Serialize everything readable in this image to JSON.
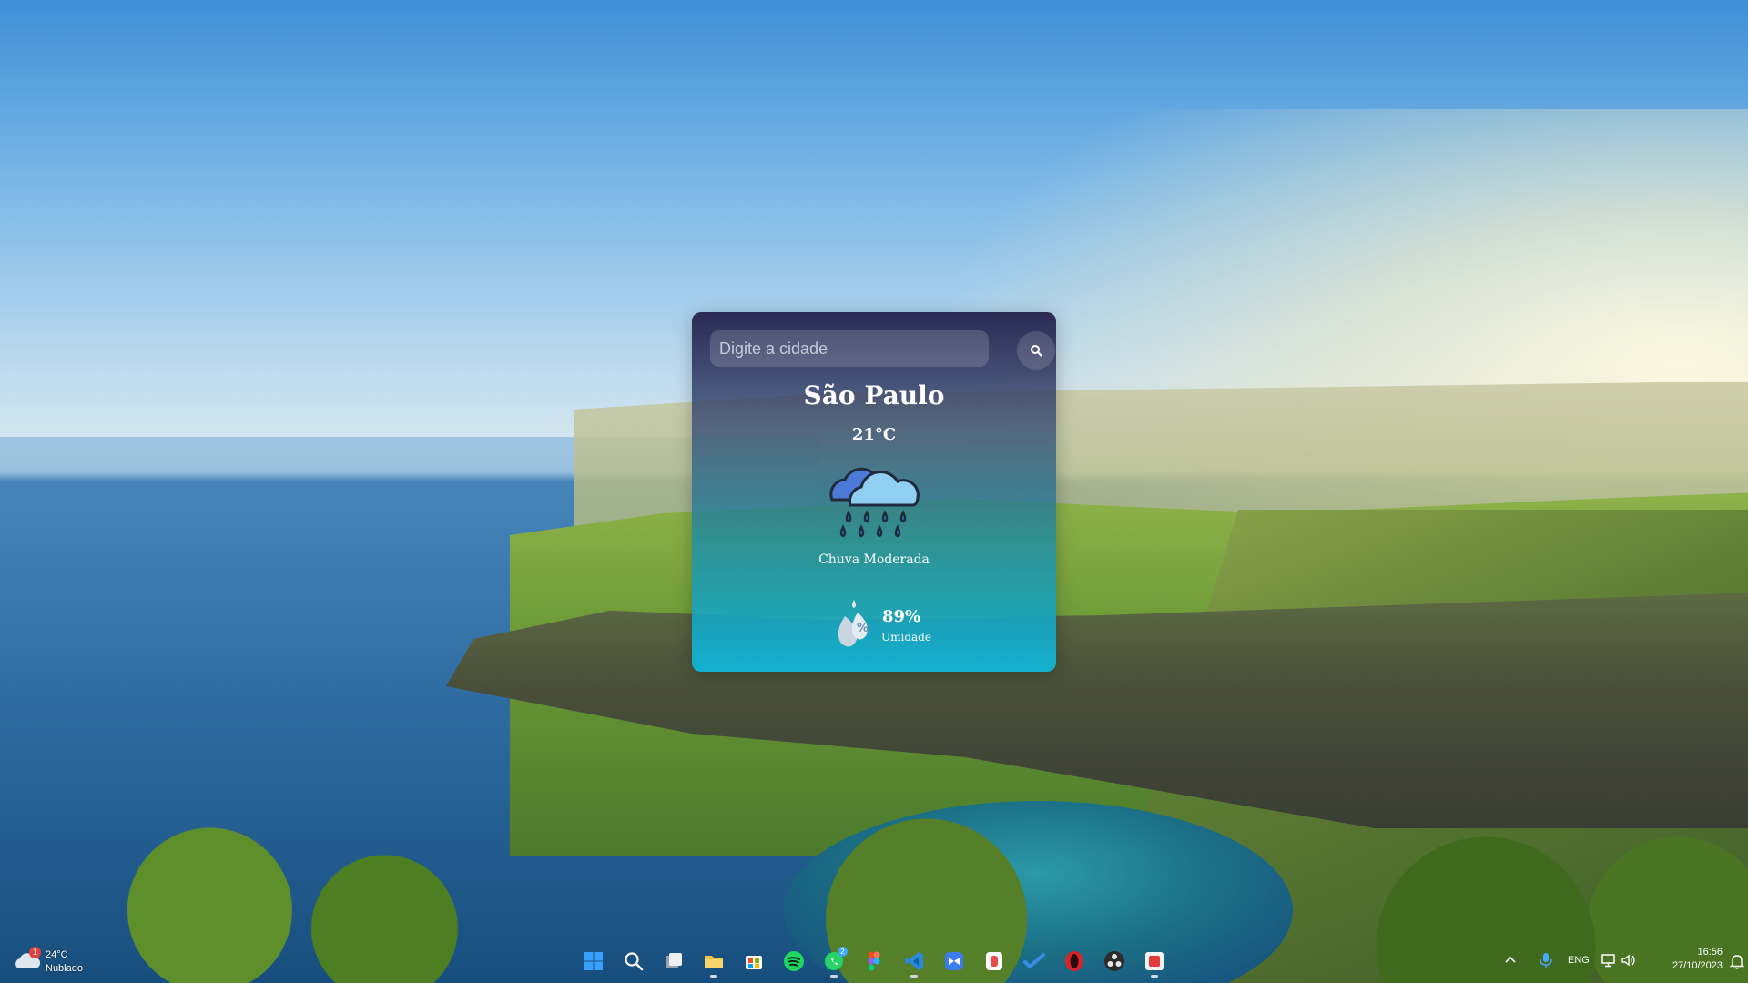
{
  "weather_app": {
    "search": {
      "placeholder": "Digite a cidade",
      "value": ""
    },
    "city": "São Paulo",
    "temperature": "21°C",
    "condition_icon": "cloud-rain-icon",
    "description": "Chuva Moderada",
    "humidity": {
      "value": "89%",
      "label": "Umidade",
      "icon": "humidity-drop-icon"
    }
  },
  "taskbar": {
    "widget": {
      "badge": "1",
      "temperature": "24°C",
      "condition": "Nublado",
      "icon": "cloudy-weather-icon"
    },
    "apps": [
      {
        "name": "start",
        "icon": "windows-start-icon",
        "color": "#3aa0ff"
      },
      {
        "name": "search",
        "icon": "search-icon",
        "color": "#ffffff"
      },
      {
        "name": "task-view",
        "icon": "task-view-icon",
        "color": "#e6e6e6"
      },
      {
        "name": "file-explorer",
        "icon": "folder-icon",
        "color": "#f6c343"
      },
      {
        "name": "microsoft-store",
        "icon": "store-icon",
        "color": "#2f8fe8"
      },
      {
        "name": "spotify",
        "icon": "spotify-icon",
        "color": "#1ed760"
      },
      {
        "name": "whatsapp",
        "icon": "whatsapp-icon",
        "color": "#25d366",
        "badge": "2"
      },
      {
        "name": "figma",
        "icon": "figma-icon",
        "color": "#a259ff"
      },
      {
        "name": "vscode",
        "icon": "vscode-icon",
        "color": "#2a8ad8"
      },
      {
        "name": "bitwarden-app",
        "icon": "app-blue-icon",
        "color": "#3b7cf0"
      },
      {
        "name": "red-app",
        "icon": "app-red-icon",
        "color": "#e94b4b"
      },
      {
        "name": "todo",
        "icon": "todo-icon",
        "color": "#3a8de6"
      },
      {
        "name": "opera",
        "icon": "opera-icon",
        "color": "#d8232a"
      },
      {
        "name": "obs",
        "icon": "obs-icon",
        "color": "#2b2b2b"
      },
      {
        "name": "red-square-app",
        "icon": "app-square-icon",
        "color": "#e23b3b"
      }
    ],
    "tray": {
      "chevron_icon": "chevron-up-icon",
      "mic_icon": "microphone-icon",
      "language": "ENG",
      "network_icon": "network-icon",
      "volume_icon": "volume-icon",
      "time": "16:56",
      "date": "27/10/2023",
      "bell_icon": "notification-bell-icon"
    }
  }
}
